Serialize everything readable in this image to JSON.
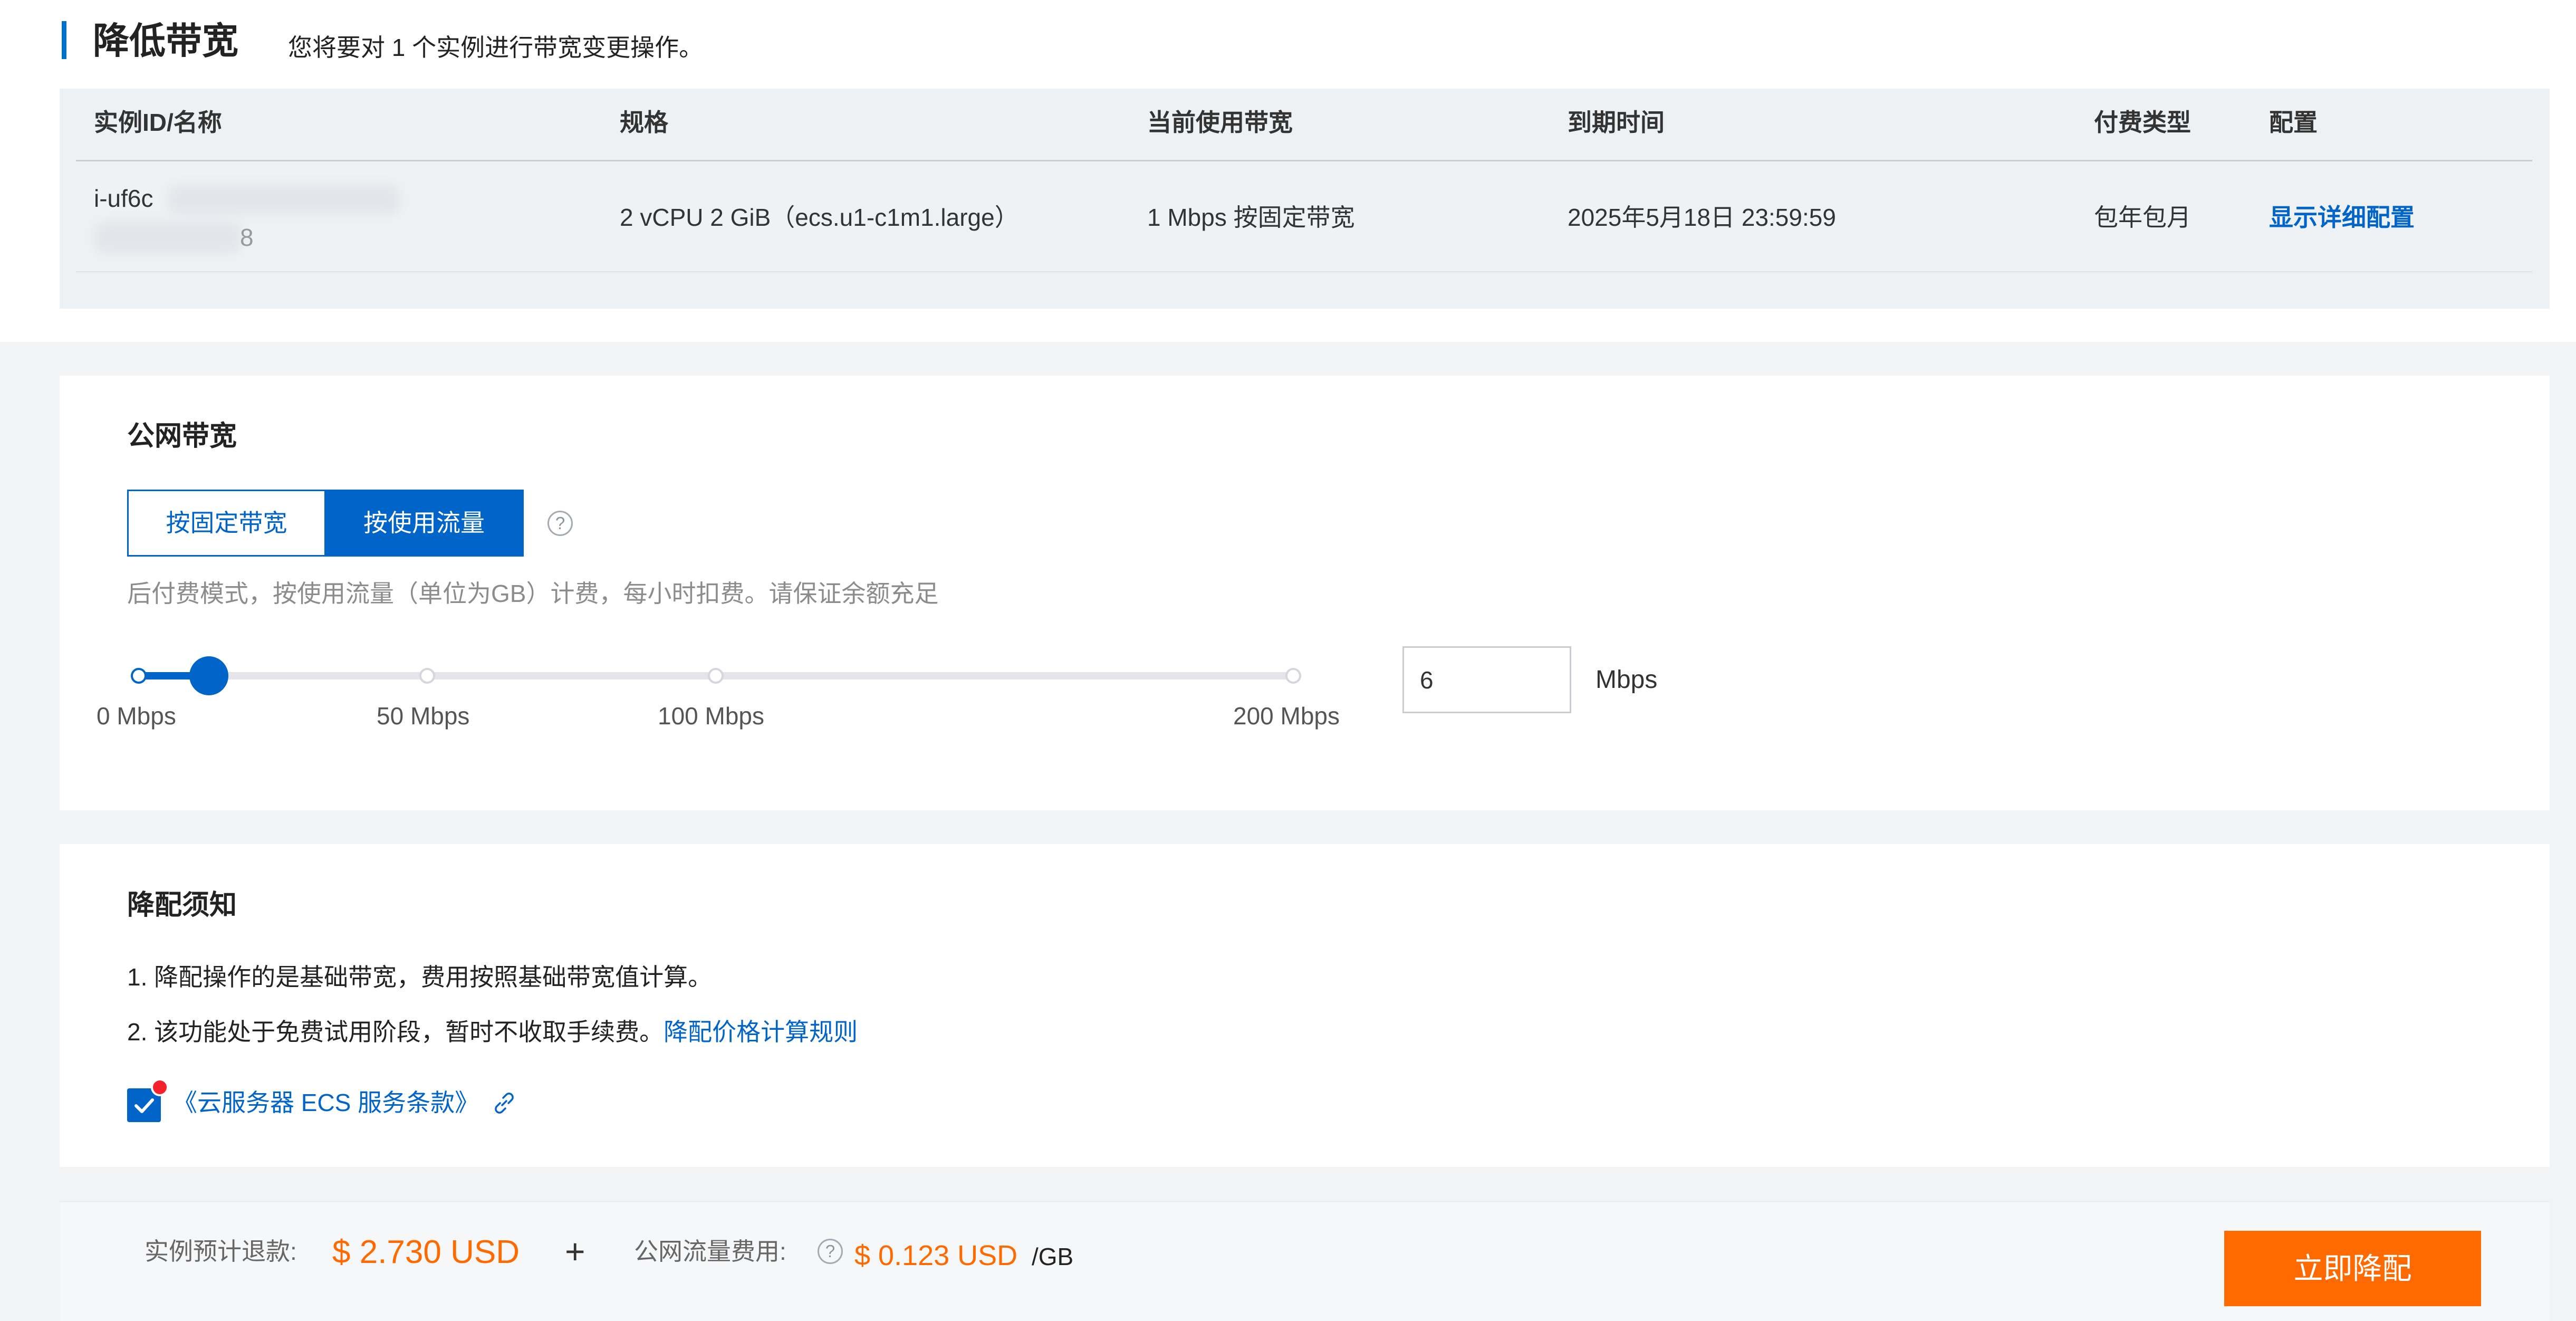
{
  "header": {
    "title": "降低带宽",
    "subtitle": "您将要对 1 个实例进行带宽变更操作。"
  },
  "table": {
    "columns": [
      "实例ID/名称",
      "规格",
      "当前使用带宽",
      "到期时间",
      "付费类型",
      "配置"
    ],
    "row": {
      "instance_id": "i-uf6c",
      "instance_name_tail": "8",
      "spec": "2 vCPU 2 GiB（ecs.u1-c1m1.large）",
      "bandwidth": "1 Mbps 按固定带宽",
      "expire": "2025年5月18日 23:59:59",
      "pay_type": "包年包月",
      "config_link": "显示详细配置"
    }
  },
  "bandwidth": {
    "title": "公网带宽",
    "mode_fixed": "按固定带宽",
    "mode_flow": "按使用流量",
    "selected_mode": "按使用流量",
    "help_glyph": "?",
    "hint": "后付费模式，按使用流量（单位为GB）计费，每小时扣费。请保证余额充足",
    "slider": {
      "marks": [
        "0 Mbps",
        "50 Mbps",
        "100 Mbps",
        "200 Mbps"
      ],
      "value": 6,
      "max": 200
    },
    "input_value": "6",
    "unit": "Mbps"
  },
  "notice": {
    "title": "降配须知",
    "item1": "1. 降配操作的是基础带宽，费用按照基础带宽值计算。",
    "item2": "2. 该功能处于免费试用阶段，暂时不收取手续费。",
    "item2_link": "降配价格计算规则",
    "terms": "《云服务器 ECS 服务条款》",
    "terms_checked": true
  },
  "footer": {
    "refund_label": "实例预计退款:",
    "refund_value": "$ 2.730 USD",
    "plus": "+",
    "traffic_label": "公网流量费用:",
    "help_glyph": "?",
    "traffic_value": "$ 0.123 USD",
    "traffic_unit": "/GB",
    "submit": "立即降配"
  },
  "colors": {
    "primary": "#0064c8",
    "orange": "#ff6a00",
    "red_dot": "#f5222d"
  }
}
